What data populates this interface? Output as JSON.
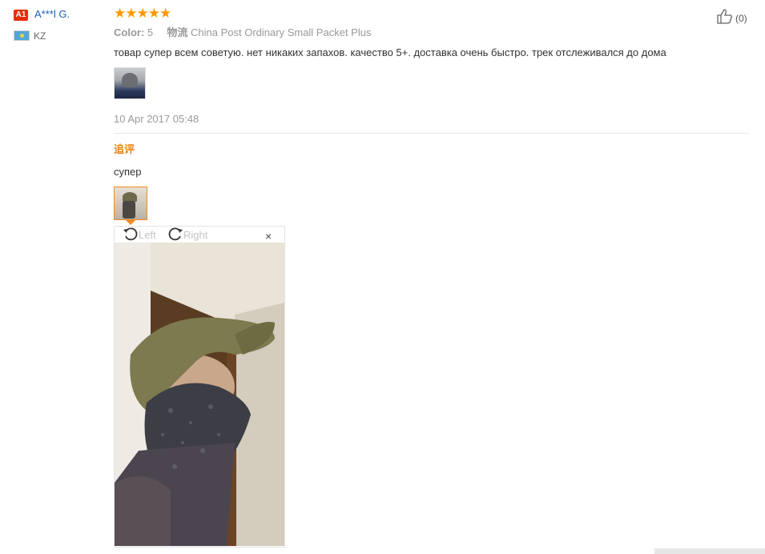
{
  "user": {
    "badge": "A1",
    "name": "A***l G.",
    "country": "KZ"
  },
  "review": {
    "stars": "★★★★★",
    "rating_count": 5,
    "color_label": "Color:",
    "color_value": "5",
    "shipping_label": "物流",
    "shipping_value": "China Post Ordinary Small Packet Plus",
    "text": "товар супер всем советую. нет никаких запахов. качество 5+. доставка очень быстро. трек отслеживался до дома",
    "date": "10 Apr 2017 05:48",
    "likes": "(0)"
  },
  "followup": {
    "title": "追评",
    "text": "супер"
  },
  "viewer": {
    "rotate_left_label": "Left",
    "rotate_right_label": "Right",
    "close_symbol": "×"
  },
  "colors": {
    "accent": "#ff9800",
    "link": "#1a5fb4",
    "followup": "#e8841a",
    "badge": "#e62e04"
  },
  "icons": {
    "like": "thumbs-up-icon",
    "rotate_left": "rotate-left-icon",
    "rotate_right": "rotate-right-icon",
    "close": "close-icon",
    "flag": "flag-kz-icon"
  }
}
